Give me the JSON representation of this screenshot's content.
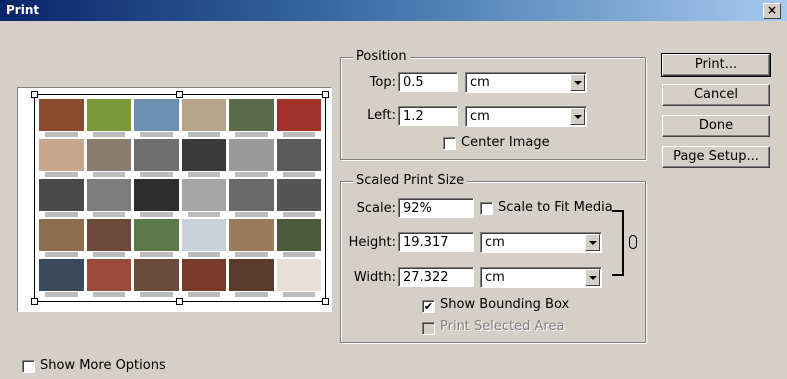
{
  "window": {
    "title": "Print",
    "close_glyph": "×"
  },
  "position": {
    "legend": "Position",
    "top_label": "Top:",
    "top_value": "0.5",
    "top_unit": "cm",
    "left_label": "Left:",
    "left_value": "1.2",
    "left_unit": "cm",
    "center_image_label": "Center Image",
    "center_image_checked": false
  },
  "scaled": {
    "legend": "Scaled Print Size",
    "scale_label": "Scale:",
    "scale_value": "92%",
    "scale_to_fit_label": "Scale to Fit Media",
    "scale_to_fit_checked": false,
    "height_label": "Height:",
    "height_value": "19.317",
    "height_unit": "cm",
    "width_label": "Width:",
    "width_value": "27.322",
    "width_unit": "cm",
    "show_bounding_box_label": "Show Bounding Box",
    "show_bounding_box_checked": true,
    "print_selected_area_label": "Print Selected Area",
    "print_selected_area_enabled": false
  },
  "buttons": {
    "print": "Print...",
    "cancel": "Cancel",
    "done": "Done",
    "page_setup": "Page Setup..."
  },
  "show_more_options_label": "Show More Options",
  "check_glyph": "✔",
  "icons": [
    "close-icon",
    "dropdown-arrow-icon",
    "link-chain-icon",
    "resize-handle-icon"
  ],
  "photo_colors": [
    "#8a4b2c",
    "#7a9a3a",
    "#6d8fb0",
    "#b8a48a",
    "#5b6a4a",
    "#a0322a",
    "#c9a78e",
    "#8a7d6b",
    "#6f6f6f",
    "#3a3a3a",
    "#9a9a9a",
    "#5a5a5a",
    "#4a4a4a",
    "#7d7d7d",
    "#2d2d2d",
    "#a5a5a5",
    "#6a6a6a",
    "#555555",
    "#8d6e4e",
    "#6b4a3a",
    "#5a7a4a",
    "#c8d0d8",
    "#9a7a5a",
    "#4a5a3a",
    "#3a4a5a",
    "#9a4a3a",
    "#6a4a3a",
    "#7a3a2a",
    "#5a3a2a",
    "#e8e0d8"
  ]
}
